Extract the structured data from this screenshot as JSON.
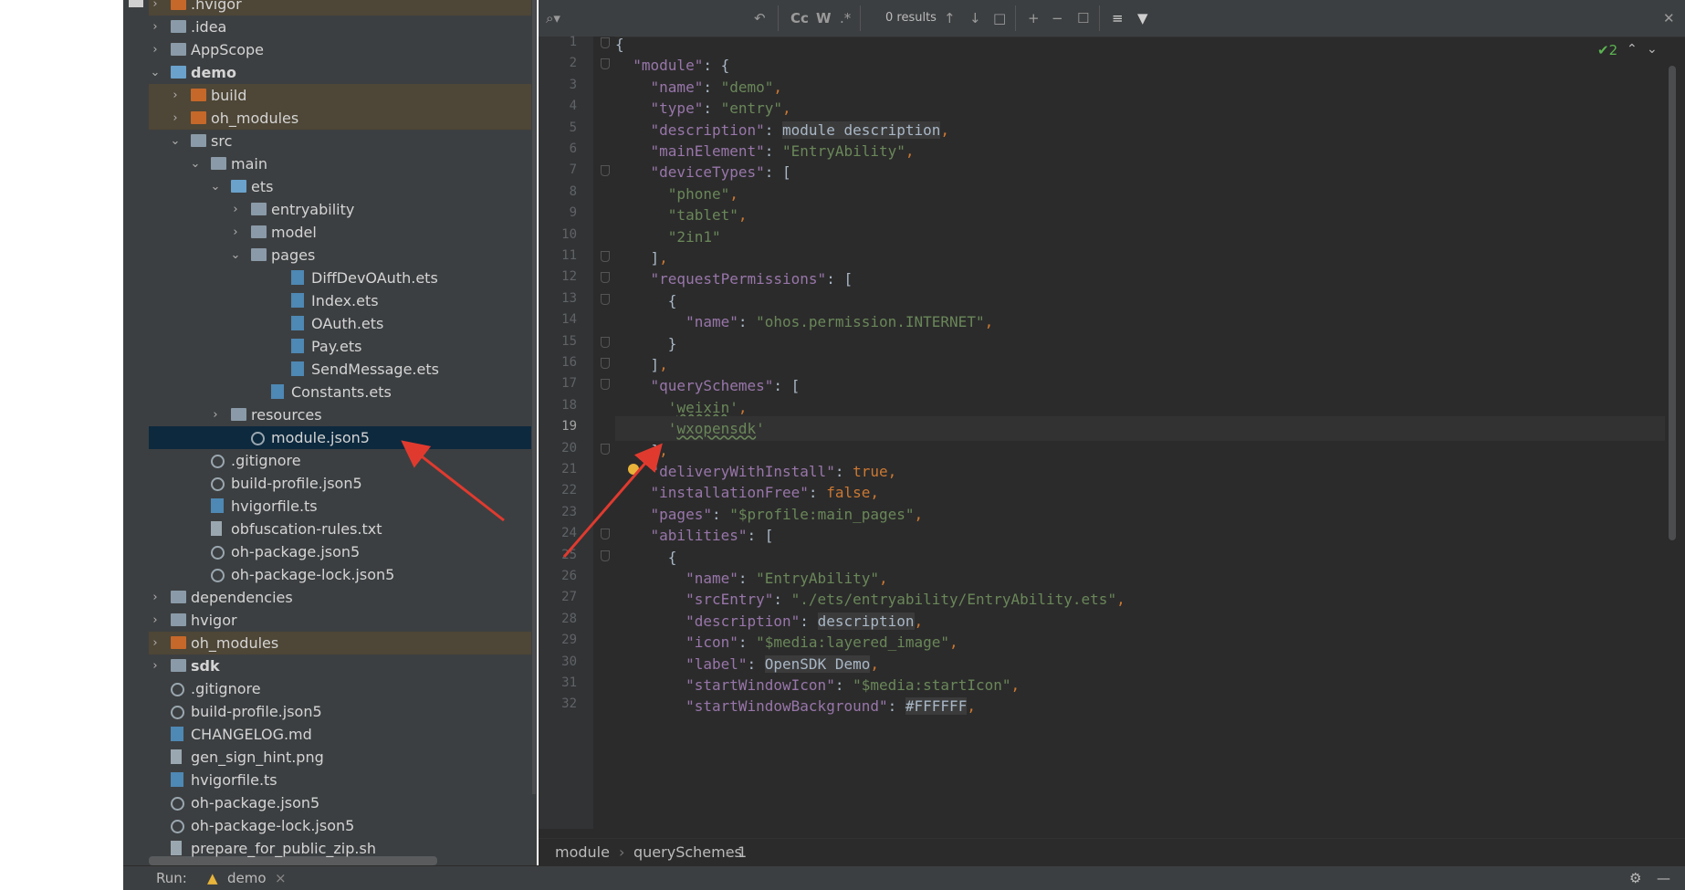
{
  "tree": [
    {
      "label": ".hvigor",
      "type": "folder-o",
      "chevron": ">",
      "style": "excluded"
    },
    {
      "label": ".idea",
      "type": "folder",
      "chevron": ">"
    },
    {
      "label": "AppScope",
      "type": "folder",
      "chevron": ">"
    },
    {
      "label": "demo",
      "type": "folder-b",
      "chevron": "v",
      "bold": true
    },
    {
      "label": "build",
      "type": "folder-o",
      "chevron": ">",
      "style": "excluded"
    },
    {
      "label": "oh_modules",
      "type": "folder-o",
      "chevron": ">",
      "style": "excluded"
    },
    {
      "label": "src",
      "type": "folder",
      "chevron": "v"
    },
    {
      "label": "main",
      "type": "folder",
      "chevron": "v"
    },
    {
      "label": "ets",
      "type": "folder-b",
      "chevron": "v"
    },
    {
      "label": "entryability",
      "type": "folder",
      "chevron": ">"
    },
    {
      "label": "model",
      "type": "folder",
      "chevron": ">"
    },
    {
      "label": "pages",
      "type": "folder",
      "chevron": "v"
    },
    {
      "label": "DiffDevOAuth.ets",
      "type": "file-ets"
    },
    {
      "label": "Index.ets",
      "type": "file-ets"
    },
    {
      "label": "OAuth.ets",
      "type": "file-ets"
    },
    {
      "label": "Pay.ets",
      "type": "file-ets"
    },
    {
      "label": "SendMessage.ets",
      "type": "file-ets"
    },
    {
      "label": "Constants.ets",
      "type": "file-ets"
    },
    {
      "label": "resources",
      "type": "folder",
      "chevron": ">"
    },
    {
      "label": "module.json5",
      "type": "file-json",
      "style": "selected"
    },
    {
      "label": ".gitignore",
      "type": "file-json"
    },
    {
      "label": "build-profile.json5",
      "type": "file-json"
    },
    {
      "label": "hvigorfile.ts",
      "type": "file-ets"
    },
    {
      "label": "obfuscation-rules.txt",
      "type": "file"
    },
    {
      "label": "oh-package.json5",
      "type": "file-json"
    },
    {
      "label": "oh-package-lock.json5",
      "type": "file-json"
    },
    {
      "label": "dependencies",
      "type": "folder",
      "chevron": ">"
    },
    {
      "label": "hvigor",
      "type": "folder",
      "chevron": ">"
    },
    {
      "label": "oh_modules",
      "type": "folder-o",
      "chevron": ">",
      "style": "excluded"
    },
    {
      "label": "sdk",
      "type": "folder",
      "chevron": ">",
      "bold": true
    },
    {
      "label": ".gitignore",
      "type": "file-json"
    },
    {
      "label": "build-profile.json5",
      "type": "file-json"
    },
    {
      "label": "CHANGELOG.md",
      "type": "file-ets"
    },
    {
      "label": "gen_sign_hint.png",
      "type": "file"
    },
    {
      "label": "hvigorfile.ts",
      "type": "file-ets"
    },
    {
      "label": "oh-package.json5",
      "type": "file-json"
    },
    {
      "label": "oh-package-lock.json5",
      "type": "file-json"
    },
    {
      "label": "prepare_for_public_zip.sh",
      "type": "file"
    }
  ],
  "findbar": {
    "search_icon": "search-icon",
    "match_case": "Cc",
    "words": "W",
    "regex": ".*",
    "results": "0 results"
  },
  "editor": {
    "inspection_count": "2",
    "current_line": 19,
    "lines": [
      "{",
      "  \"module\": {",
      "    \"name\": \"demo\",",
      "    \"type\": \"entry\",",
      "    \"description\": module description,",
      "    \"mainElement\": \"EntryAbility\",",
      "    \"deviceTypes\": [",
      "      \"phone\",",
      "      \"tablet\",",
      "      \"2in1\"",
      "    ],",
      "    \"requestPermissions\": [",
      "      {",
      "        \"name\": \"ohos.permission.INTERNET\",",
      "      }",
      "    ],",
      "    \"querySchemes\": [",
      "      'weixin',",
      "      'wxopensdk'",
      "    ],",
      "    \"deliveryWithInstall\": true,",
      "    \"installationFree\": false,",
      "    \"pages\": \"$profile:main_pages\",",
      "    \"abilities\": [",
      "      {",
      "        \"name\": \"EntryAbility\",",
      "        \"srcEntry\": \"./ets/entryability/EntryAbility.ets\",",
      "        \"description\": description,",
      "        \"icon\": \"$media:layered_image\",",
      "        \"label\": OpenSDK Demo,",
      "        \"startWindowIcon\": \"$media:startIcon\",",
      "        \"startWindowBackground\": #FFFFFF,"
    ]
  },
  "breadcrumb": [
    "module",
    "querySchemes",
    "1"
  ],
  "bottom": {
    "run_label": "Run:",
    "run_config": "demo"
  },
  "colors": {
    "property": "#9876aa",
    "string": "#6a8759",
    "keyword": "#cc7832",
    "annotation_arrow": "#e03a2f"
  }
}
